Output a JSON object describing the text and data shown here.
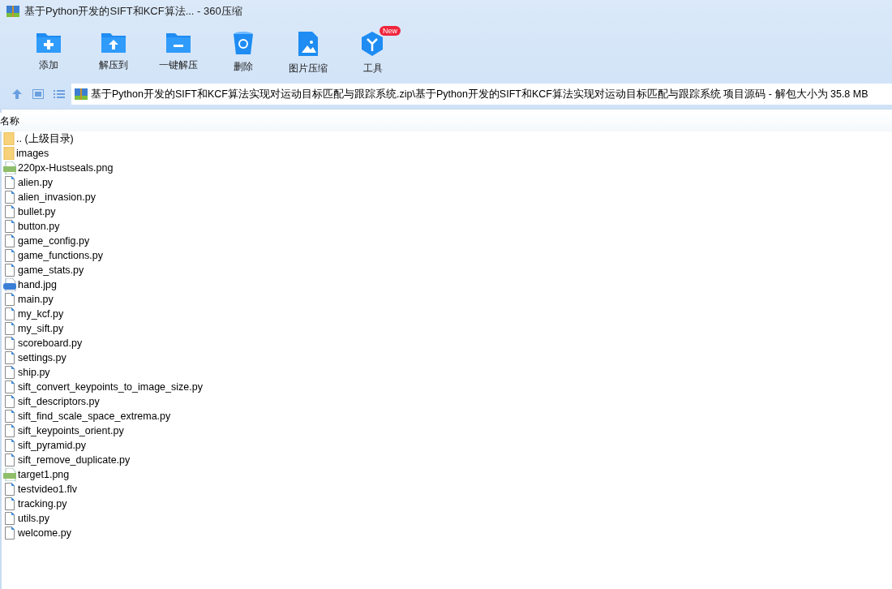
{
  "window": {
    "title": "基于Python开发的SIFT和KCF算法... - 360压缩"
  },
  "toolbar": [
    {
      "kind": "add",
      "label": "添加"
    },
    {
      "kind": "extract_to",
      "label": "解压到"
    },
    {
      "kind": "extract",
      "label": "一键解压"
    },
    {
      "kind": "delete",
      "label": "删除"
    },
    {
      "kind": "image",
      "label": "图片压缩"
    },
    {
      "kind": "tools",
      "label": "工具",
      "badge": "New"
    }
  ],
  "address_bar": {
    "path": "基于Python开发的SIFT和KCF算法实现对运动目标匹配与跟踪系统.zip\\基于Python开发的SIFT和KCF算法实现对运动目标匹配与跟踪系统 项目源码 - 解包大小为 35.8 MB"
  },
  "file_list": {
    "columns": [
      "名称"
    ],
    "rows": [
      {
        "kind": "folder",
        "name": ".. (上级目录)"
      },
      {
        "kind": "folder",
        "name": "images"
      },
      {
        "kind": "png",
        "name": "220px-Hustseals.png"
      },
      {
        "kind": "file",
        "name": "alien.py"
      },
      {
        "kind": "file",
        "name": "alien_invasion.py"
      },
      {
        "kind": "file",
        "name": "bullet.py"
      },
      {
        "kind": "file",
        "name": "button.py"
      },
      {
        "kind": "file",
        "name": "game_config.py"
      },
      {
        "kind": "file",
        "name": "game_functions.py"
      },
      {
        "kind": "file",
        "name": "game_stats.py"
      },
      {
        "kind": "jpg",
        "name": "hand.jpg"
      },
      {
        "kind": "file",
        "name": "main.py"
      },
      {
        "kind": "file",
        "name": "my_kcf.py"
      },
      {
        "kind": "file",
        "name": "my_sift.py"
      },
      {
        "kind": "file",
        "name": "scoreboard.py"
      },
      {
        "kind": "file",
        "name": "settings.py"
      },
      {
        "kind": "file",
        "name": "ship.py"
      },
      {
        "kind": "file",
        "name": "sift_convert_keypoints_to_image_size.py"
      },
      {
        "kind": "file",
        "name": "sift_descriptors.py"
      },
      {
        "kind": "file",
        "name": "sift_find_scale_space_extrema.py"
      },
      {
        "kind": "file",
        "name": "sift_keypoints_orient.py"
      },
      {
        "kind": "file",
        "name": "sift_pyramid.py"
      },
      {
        "kind": "file",
        "name": "sift_remove_duplicate.py"
      },
      {
        "kind": "png",
        "name": "target1.png"
      },
      {
        "kind": "file",
        "name": "testvideo1.flv"
      },
      {
        "kind": "file",
        "name": "tracking.py"
      },
      {
        "kind": "file",
        "name": "utils.py"
      },
      {
        "kind": "file",
        "name": "welcome.py"
      }
    ]
  }
}
